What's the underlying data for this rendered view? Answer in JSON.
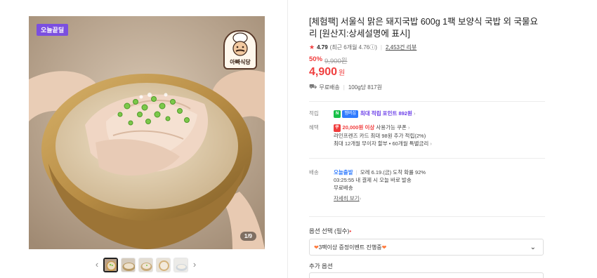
{
  "gallery": {
    "badge": "오늘끝딜",
    "brand_logo_text": "아빠식당",
    "counter": "1/9",
    "prev_arrow": "‹",
    "next_arrow": "›",
    "thumbnail_count": 5
  },
  "product": {
    "title": "[체험팩] 서울식 맑은 돼지국밥 600g 1팩 보양식 국밥 외 국물요리 [원산지:상세설명에 표시]",
    "rating": {
      "star": "★",
      "score": "4.79",
      "recent": "(최근 6개월 4.76ⓘ)",
      "review_count": "2,453건 리뷰"
    },
    "discount": "50%",
    "original_price": "9,900원",
    "price": "4,900",
    "price_unit": "원",
    "shipping": {
      "icon": "truck-icon",
      "text": "무료배송",
      "unit_price": "100g당 817원"
    }
  },
  "benefits": {
    "points": {
      "label": "적립",
      "n_badge": "N",
      "plus_badge": "멤버십",
      "text": "최대 적립 포인트 892원",
      "chevron": "›"
    },
    "perks": {
      "label": "혜택",
      "coupon_badge": "쿠",
      "coupon_amount": "20,000원 이상",
      "coupon_text": "사용가능 쿠폰",
      "line2": "라인프렌즈 카드 최대 98원 추가 적립(2%)",
      "line3": "최대 12개월 무이자 할부 • 60개월 특별금리",
      "chevron": "›"
    },
    "delivery": {
      "label": "배송",
      "today": "오늘출발",
      "arrival": "모레 6.19.(금) 도착 확률 92%",
      "countdown": "03:25:55",
      "countdown_text": "내 결제 시 오늘 바로 발송",
      "fee": "무료배송",
      "more": "자세히 보기",
      "chevron": "›"
    }
  },
  "options": {
    "label": "옵션 선택 (필수)",
    "required_mark": "•",
    "selected": "3팩이상 증정이벤트 진행중",
    "heart_icon": "heart-icon",
    "chevron": "⌄",
    "addon_label": "추가 옵션"
  },
  "colors": {
    "accent_red": "#f03e3e",
    "badge_purple": "#7b4fe0",
    "naver_green": "#18c048",
    "delivery_blue": "#2f7bff"
  }
}
